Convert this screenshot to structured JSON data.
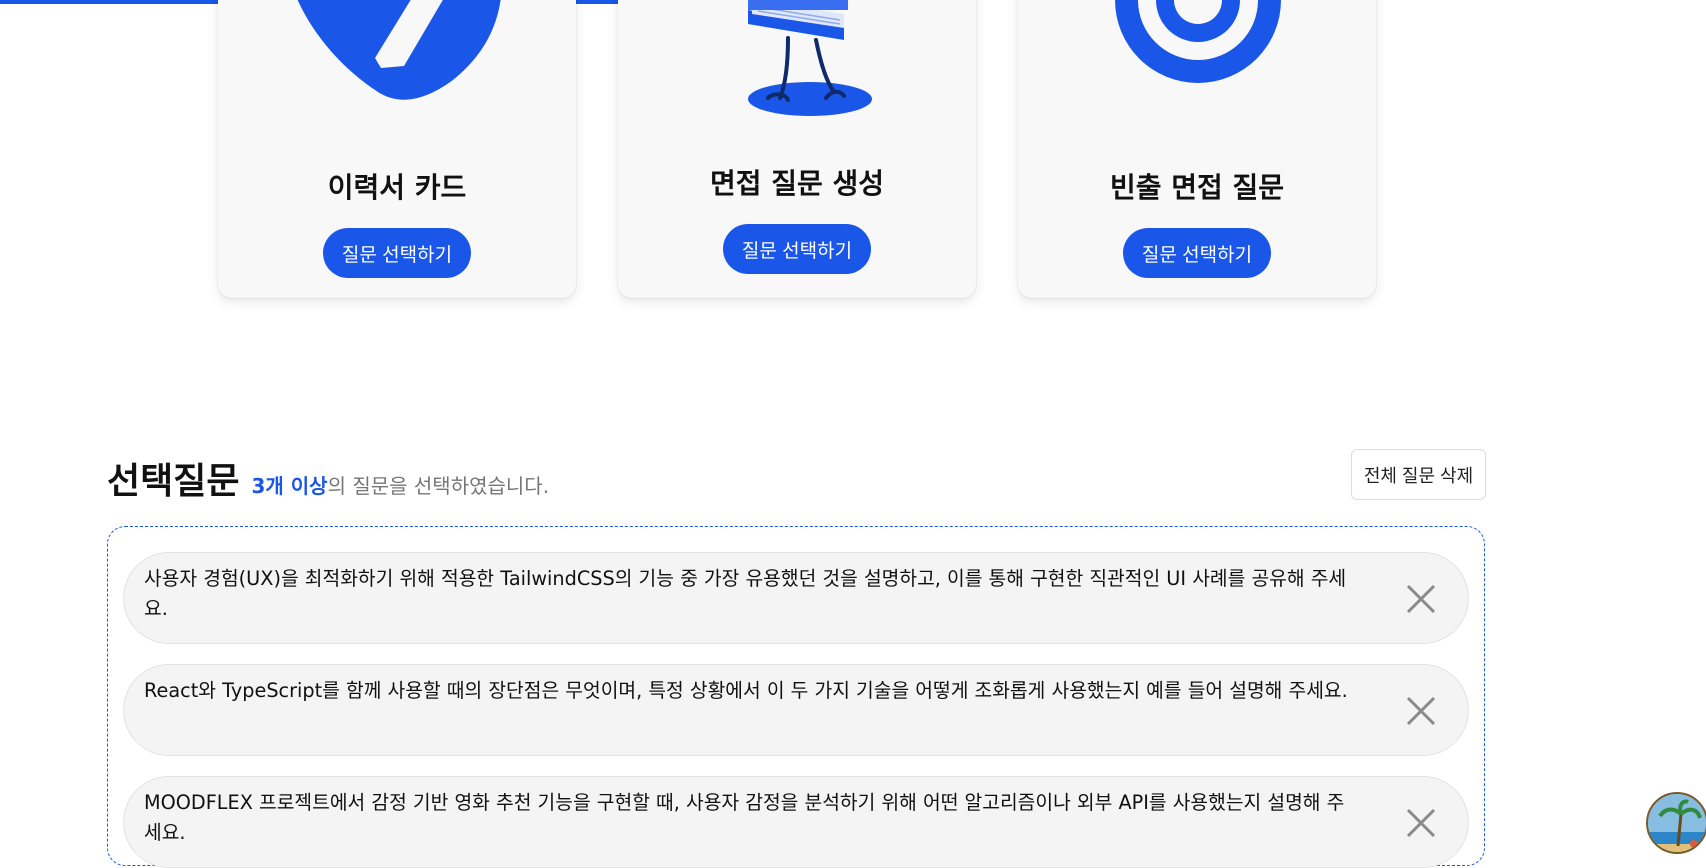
{
  "cards": [
    {
      "title": "이력서 카드",
      "button": "질문 선택하기",
      "icon": "resume-pencil-icon"
    },
    {
      "title": "면접 질문 생성",
      "button": "질문 선택하기",
      "icon": "walking-book-icon"
    },
    {
      "title": "빈출 면접 질문",
      "button": "질문 선택하기",
      "icon": "target-icon"
    }
  ],
  "selected": {
    "title": "선택질문",
    "count_text": "3개 이상",
    "suffix_text": "의 질문을 선택하였습니다.",
    "delete_all_label": "전체 질문 삭제"
  },
  "questions": [
    {
      "text": "사용자 경험(UX)을 최적화하기 위해 적용한 TailwindCSS의 기능 중 가장 유용했던 것을 설명하고, 이를 통해 구현한 직관적인 UI 사례를 공유해 주세요."
    },
    {
      "text": "React와 TypeScript를 함께 사용할 때의 장단점은 무엇이며, 특정 상황에서 이 두 가지 기술을 어떻게 조화롭게 사용했는지 예를 들어 설명해 주세요."
    },
    {
      "text": "MOODFLEX 프로젝트에서 감정 기반 영화 추천 기능을 구현할 때, 사용자 감정을 분석하기 위해 어떤 알고리즘이나 외부 API를 사용했는지 설명해 주세요."
    }
  ],
  "colors": {
    "accent": "#1a56e8",
    "card_bg": "#f8f8f8",
    "pill_bg": "#f4f4f4"
  }
}
